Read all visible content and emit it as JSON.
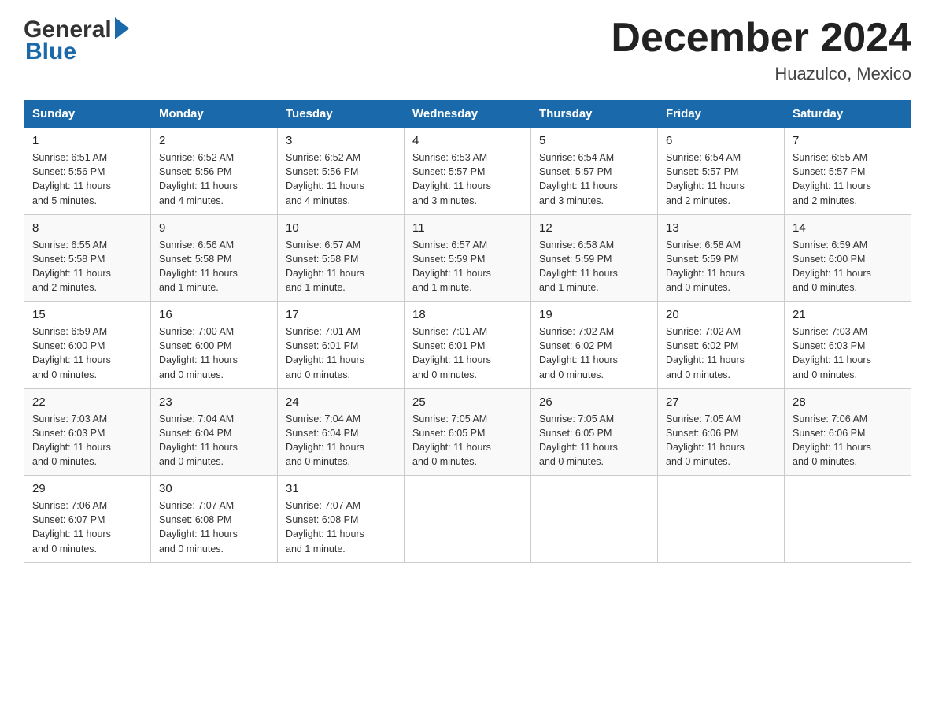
{
  "header": {
    "logo_text_general": "General",
    "logo_text_blue": "Blue",
    "title": "December 2024",
    "subtitle": "Huazulco, Mexico"
  },
  "days_of_week": [
    "Sunday",
    "Monday",
    "Tuesday",
    "Wednesday",
    "Thursday",
    "Friday",
    "Saturday"
  ],
  "weeks": [
    [
      {
        "day": "1",
        "sunrise": "6:51 AM",
        "sunset": "5:56 PM",
        "daylight": "11 hours and 5 minutes."
      },
      {
        "day": "2",
        "sunrise": "6:52 AM",
        "sunset": "5:56 PM",
        "daylight": "11 hours and 4 minutes."
      },
      {
        "day": "3",
        "sunrise": "6:52 AM",
        "sunset": "5:56 PM",
        "daylight": "11 hours and 4 minutes."
      },
      {
        "day": "4",
        "sunrise": "6:53 AM",
        "sunset": "5:57 PM",
        "daylight": "11 hours and 3 minutes."
      },
      {
        "day": "5",
        "sunrise": "6:54 AM",
        "sunset": "5:57 PM",
        "daylight": "11 hours and 3 minutes."
      },
      {
        "day": "6",
        "sunrise": "6:54 AM",
        "sunset": "5:57 PM",
        "daylight": "11 hours and 2 minutes."
      },
      {
        "day": "7",
        "sunrise": "6:55 AM",
        "sunset": "5:57 PM",
        "daylight": "11 hours and 2 minutes."
      }
    ],
    [
      {
        "day": "8",
        "sunrise": "6:55 AM",
        "sunset": "5:58 PM",
        "daylight": "11 hours and 2 minutes."
      },
      {
        "day": "9",
        "sunrise": "6:56 AM",
        "sunset": "5:58 PM",
        "daylight": "11 hours and 1 minute."
      },
      {
        "day": "10",
        "sunrise": "6:57 AM",
        "sunset": "5:58 PM",
        "daylight": "11 hours and 1 minute."
      },
      {
        "day": "11",
        "sunrise": "6:57 AM",
        "sunset": "5:59 PM",
        "daylight": "11 hours and 1 minute."
      },
      {
        "day": "12",
        "sunrise": "6:58 AM",
        "sunset": "5:59 PM",
        "daylight": "11 hours and 1 minute."
      },
      {
        "day": "13",
        "sunrise": "6:58 AM",
        "sunset": "5:59 PM",
        "daylight": "11 hours and 0 minutes."
      },
      {
        "day": "14",
        "sunrise": "6:59 AM",
        "sunset": "6:00 PM",
        "daylight": "11 hours and 0 minutes."
      }
    ],
    [
      {
        "day": "15",
        "sunrise": "6:59 AM",
        "sunset": "6:00 PM",
        "daylight": "11 hours and 0 minutes."
      },
      {
        "day": "16",
        "sunrise": "7:00 AM",
        "sunset": "6:00 PM",
        "daylight": "11 hours and 0 minutes."
      },
      {
        "day": "17",
        "sunrise": "7:01 AM",
        "sunset": "6:01 PM",
        "daylight": "11 hours and 0 minutes."
      },
      {
        "day": "18",
        "sunrise": "7:01 AM",
        "sunset": "6:01 PM",
        "daylight": "11 hours and 0 minutes."
      },
      {
        "day": "19",
        "sunrise": "7:02 AM",
        "sunset": "6:02 PM",
        "daylight": "11 hours and 0 minutes."
      },
      {
        "day": "20",
        "sunrise": "7:02 AM",
        "sunset": "6:02 PM",
        "daylight": "11 hours and 0 minutes."
      },
      {
        "day": "21",
        "sunrise": "7:03 AM",
        "sunset": "6:03 PM",
        "daylight": "11 hours and 0 minutes."
      }
    ],
    [
      {
        "day": "22",
        "sunrise": "7:03 AM",
        "sunset": "6:03 PM",
        "daylight": "11 hours and 0 minutes."
      },
      {
        "day": "23",
        "sunrise": "7:04 AM",
        "sunset": "6:04 PM",
        "daylight": "11 hours and 0 minutes."
      },
      {
        "day": "24",
        "sunrise": "7:04 AM",
        "sunset": "6:04 PM",
        "daylight": "11 hours and 0 minutes."
      },
      {
        "day": "25",
        "sunrise": "7:05 AM",
        "sunset": "6:05 PM",
        "daylight": "11 hours and 0 minutes."
      },
      {
        "day": "26",
        "sunrise": "7:05 AM",
        "sunset": "6:05 PM",
        "daylight": "11 hours and 0 minutes."
      },
      {
        "day": "27",
        "sunrise": "7:05 AM",
        "sunset": "6:06 PM",
        "daylight": "11 hours and 0 minutes."
      },
      {
        "day": "28",
        "sunrise": "7:06 AM",
        "sunset": "6:06 PM",
        "daylight": "11 hours and 0 minutes."
      }
    ],
    [
      {
        "day": "29",
        "sunrise": "7:06 AM",
        "sunset": "6:07 PM",
        "daylight": "11 hours and 0 minutes."
      },
      {
        "day": "30",
        "sunrise": "7:07 AM",
        "sunset": "6:08 PM",
        "daylight": "11 hours and 0 minutes."
      },
      {
        "day": "31",
        "sunrise": "7:07 AM",
        "sunset": "6:08 PM",
        "daylight": "11 hours and 1 minute."
      },
      null,
      null,
      null,
      null
    ]
  ],
  "sunrise_label": "Sunrise:",
  "sunset_label": "Sunset:",
  "daylight_label": "Daylight:"
}
